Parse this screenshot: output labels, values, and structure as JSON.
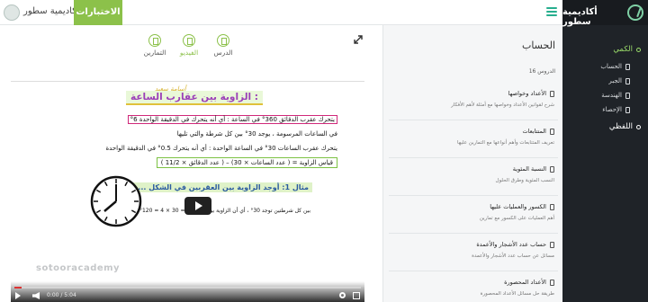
{
  "topbar": {
    "site_name": "أكاديمية سطور",
    "quiz_label": "الاختبارات"
  },
  "sidebar": {
    "title": "أكاديمية سطور",
    "sections": [
      {
        "label": "الكمي",
        "items": [
          "الحساب",
          "الجبر",
          "الهندسة",
          "الإحصاء"
        ]
      },
      {
        "label": "اللفظي",
        "items": []
      }
    ]
  },
  "tabs": [
    {
      "label": "الدرس"
    },
    {
      "label": "الفيديو"
    },
    {
      "label": "التمارين"
    }
  ],
  "video": {
    "handwriting": "أسامة سعيد",
    "title": "الزاوية بين عقارب الساعة :",
    "lines": [
      "يتحرك عقرب الدقائق 360° في الساعة : أي أنه يتحرك في الدقيقة الواحدة 6°",
      "في الساعات المرسومة ، يوجد 30° بين كل شرطة والتي تليها",
      "يتحرك عقرب الساعات 30° في الساعة الواحدة : أي أنه يتحرك 0.5° في الدقيقة الواحدة",
      "قياس الزاوية = ( عدد الساعات × 30) – ( عدد الدقائق × 11/2 )"
    ],
    "example": "مثال 1: أوجد الزاوية بين العقربين في الشكل ... تقريباً:",
    "solution": "بين كل شرطتين توجد 30° ، أي أن الزاوية بين العقربين = 30 × 4 = 120°",
    "watermark": "sotooracademy",
    "time": "0:00 / 5:04",
    "progress": 0.02
  },
  "panel": {
    "title": "الحساب",
    "count": "الدروس 16",
    "lessons": [
      {
        "title": "الأعداد وخواصها",
        "desc": "شرح لقوانين الأعداد وخواصها مع أمثلة لأهم الأفكار"
      },
      {
        "title": "المتتابعات",
        "desc": "تعريف المتتابعات وأهم أنواعها مع التمارين عليها"
      },
      {
        "title": "النسبة المئوية",
        "desc": "النسب المئوية وطرق الحلول"
      },
      {
        "title": "الكسور والعمليات عليها",
        "desc": "أهم العمليات على الكسور مع تمارين"
      },
      {
        "title": "حساب عدد الأشجار والأعمدة",
        "desc": "مسائل عن حساب عدد الأشجار والأعمدة"
      },
      {
        "title": "الأعداد المحصورة",
        "desc": "طريقة حل مسائل الأعداد المحصورة"
      }
    ]
  }
}
